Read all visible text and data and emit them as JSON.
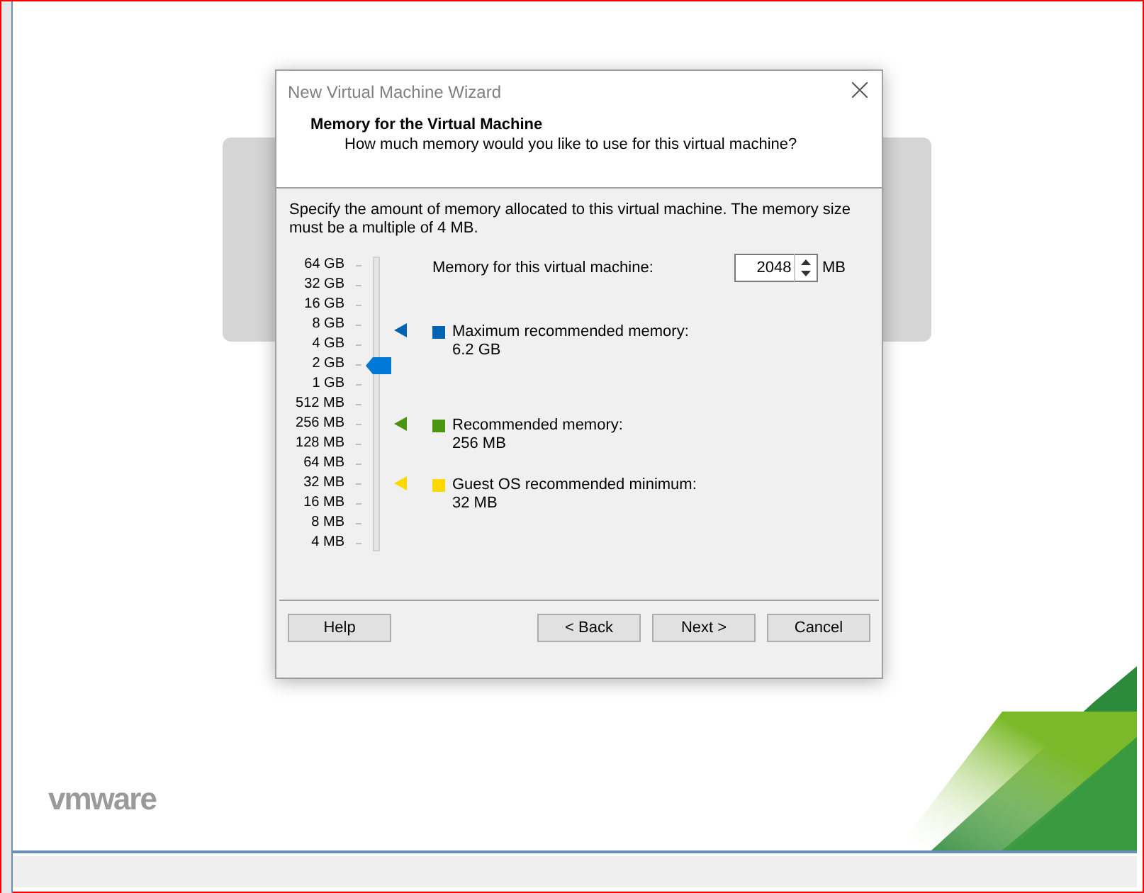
{
  "logo": "vmware",
  "dialog": {
    "title": "New Virtual Machine Wizard",
    "heading": "Memory for the Virtual Machine",
    "subheading": "How much memory would you like to use for this virtual machine?",
    "description": "Specify the amount of memory allocated to this virtual machine. The memory size must be a multiple of 4 MB.",
    "scale": [
      "64 GB",
      "32 GB",
      "16 GB",
      "8 GB",
      "4 GB",
      "2 GB",
      "1 GB",
      "512 MB",
      "256 MB",
      "128 MB",
      "64 MB",
      "32 MB",
      "16 MB",
      "8 MB",
      "4 MB"
    ],
    "slider": {
      "level": 0.643
    },
    "memory_label": "Memory for this virtual machine:",
    "memory_value": "2048",
    "memory_unit": "MB",
    "legend": [
      {
        "label": "Maximum recommended memory:",
        "value": "6.2 GB",
        "color": "#0063b1",
        "level": 0.764
      },
      {
        "label": "Recommended memory:",
        "value": "256 MB",
        "color": "#4b9611",
        "level": 0.4286
      },
      {
        "label": "Guest OS recommended minimum:",
        "value": "32 MB",
        "color": "#ffd800",
        "level": 0.214
      }
    ],
    "buttons": [
      {
        "label": "Help",
        "kind": "left"
      },
      {
        "label": "< Back",
        "kind": "right"
      },
      {
        "label": "Next >",
        "kind": "right"
      },
      {
        "label": "Cancel",
        "kind": "right"
      }
    ]
  }
}
